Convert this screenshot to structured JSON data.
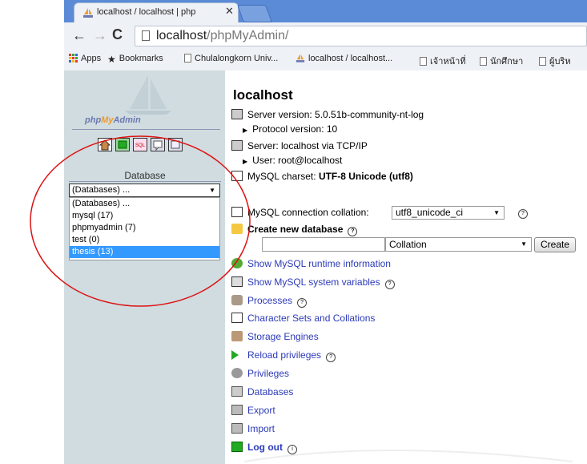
{
  "browser": {
    "tab_title": "localhost / localhost | php",
    "tab_close": "✕",
    "url_host": "localhost",
    "url_path": "/phpMyAdmin/",
    "bookmarks": [
      {
        "label": "Apps"
      },
      {
        "label": "Bookmarks"
      },
      {
        "label": "Chulalongkorn Univ..."
      },
      {
        "label": "localhost / localhost..."
      },
      {
        "label": "เจ้าหน้าที่"
      },
      {
        "label": "นักศึกษา"
      },
      {
        "label": "ผู้บริห"
      }
    ]
  },
  "sidebar": {
    "logo": {
      "php": "php",
      "my": "My",
      "admin": "Admin"
    },
    "database_label": "Database",
    "select_value": "(Databases) ...",
    "options": [
      {
        "label": "(Databases) ..."
      },
      {
        "label": "mysql (17)"
      },
      {
        "label": "phpmyadmin (7)"
      },
      {
        "label": "test (0)"
      },
      {
        "label": "thesis (13)"
      }
    ],
    "selected_option": "thesis (13)"
  },
  "main": {
    "title": "localhost",
    "server_version": "Server version: 5.0.51b-community-nt-log",
    "protocol_version": "Protocol version: 10",
    "server": "Server: localhost via TCP/IP",
    "user": "User: root@localhost",
    "charset_label": "MySQL charset:",
    "charset_value": "UTF-8 Unicode (utf8)",
    "collation_label": "MySQL connection collation:",
    "collation_value": "utf8_unicode_ci",
    "create_db_label": "Create new database",
    "new_db_collation_placeholder": "Collation",
    "create_button": "Create",
    "links": {
      "runtime": "Show MySQL runtime information",
      "variables": "Show MySQL system variables",
      "processes": "Processes",
      "charsets": "Character Sets and Collations",
      "engines": "Storage Engines",
      "reload": "Reload privileges",
      "privileges": "Privileges",
      "databases": "Databases",
      "export": "Export",
      "import": "Import",
      "logout": "Log out"
    },
    "hint_glyph": "?",
    "hint_glyph_alt": "i"
  },
  "colors": {
    "annotation": "#d11",
    "link": "#2c3ab8",
    "sidebar_bg": "#d0dce0",
    "selected": "#3399ff"
  }
}
